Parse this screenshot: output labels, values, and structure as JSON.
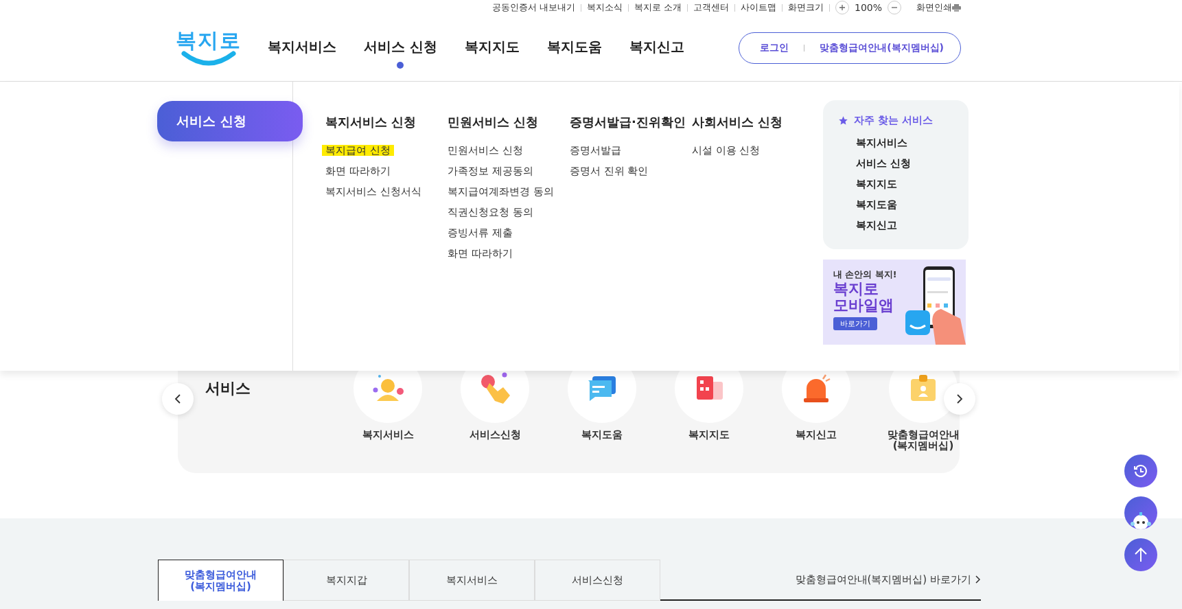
{
  "utility_links": [
    "공동인증서 내보내기",
    "복지소식",
    "복지로 소개",
    "고객센터",
    "사이트맵",
    "화면크기"
  ],
  "zoom": {
    "value": "100%"
  },
  "print": "화면인쇄",
  "logo": "복지로",
  "nav": [
    {
      "label": "복지서비스",
      "selected": false
    },
    {
      "label": "서비스 신청",
      "selected": true
    },
    {
      "label": "복지지도",
      "selected": false
    },
    {
      "label": "복지도움",
      "selected": false
    },
    {
      "label": "복지신고",
      "selected": false
    }
  ],
  "account": {
    "login": "로그인",
    "membership": "맞춤형급여안내(복지멤버십)"
  },
  "mega_menu": {
    "title": "서비스 신청",
    "columns": [
      {
        "heading": "복지서비스 신청",
        "items": [
          {
            "label": "복지급여 신청",
            "highlighted": true
          },
          {
            "label": "화면 따라하기",
            "highlighted": false
          },
          {
            "label": "복지서비스 신청서식",
            "highlighted": false
          }
        ]
      },
      {
        "heading": "민원서비스 신청",
        "items": [
          {
            "label": "민원서비스 신청",
            "highlighted": false
          },
          {
            "label": "가족정보 제공동의",
            "highlighted": false
          },
          {
            "label": "복지급여계좌변경 동의",
            "highlighted": false
          },
          {
            "label": "직권신청요청 동의",
            "highlighted": false
          },
          {
            "label": "증빙서류 제출",
            "highlighted": false
          },
          {
            "label": "화면 따라하기",
            "highlighted": false
          }
        ]
      },
      {
        "heading": "증명서발급·진위확인",
        "items": [
          {
            "label": "증명서발급",
            "highlighted": false
          },
          {
            "label": "증명서 진위 확인",
            "highlighted": false
          }
        ]
      },
      {
        "heading": "사회서비스 신청",
        "items": [
          {
            "label": "시설 이용 신청",
            "highlighted": false
          }
        ]
      }
    ]
  },
  "favorites": {
    "title": "자주 찾는 서비스",
    "items": [
      "복지서비스",
      "서비스 신청",
      "복지지도",
      "복지도움",
      "복지신고"
    ]
  },
  "banner": {
    "eyebrow": "내 손안의 복지!",
    "title_lines": [
      "복지로",
      "모바일앱"
    ],
    "button": "바로가기"
  },
  "quick_services": {
    "title": "서비스",
    "items": [
      {
        "label": "복지서비스",
        "kind": "person"
      },
      {
        "label": "서비스신청",
        "kind": "hand"
      },
      {
        "label": "복지도움",
        "kind": "chat"
      },
      {
        "label": "복지지도",
        "kind": "map"
      },
      {
        "label": "복지신고",
        "kind": "siren"
      },
      {
        "label": "맞춤형급여안내\n(복지멤버십)",
        "kind": "card"
      }
    ]
  },
  "bottom_tabs": [
    {
      "label": "맞춤형급여안내\n(복지멤버십)",
      "selected": true
    },
    {
      "label": "복지지갑",
      "selected": false
    },
    {
      "label": "복지서비스",
      "selected": false
    },
    {
      "label": "서비스신청",
      "selected": false
    }
  ],
  "shortcut": "맞춤형급여안내(복지멤버십) 바로가기"
}
